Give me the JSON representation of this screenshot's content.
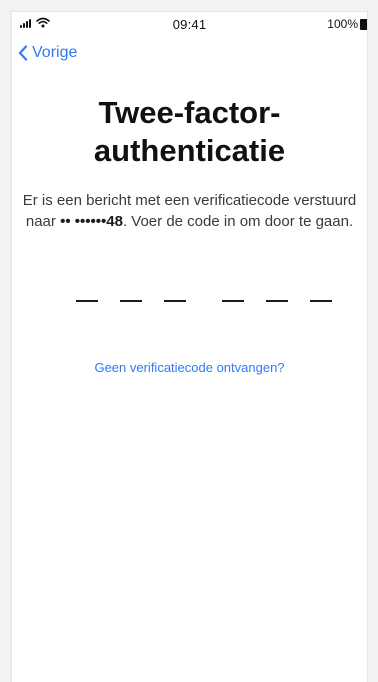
{
  "status_bar": {
    "time": "09:41",
    "battery_percent": "100%"
  },
  "navigation": {
    "back_label": "Vorige"
  },
  "title": "Twee-factor-authenticatie",
  "description": {
    "text_before": "Er is een bericht met een verificatiecode verstuurd naar ",
    "masked_number": "•• ••••••48",
    "text_after": ". Voer de code in om door te gaan."
  },
  "code_entry": {
    "digit_count": 6,
    "group_size": 3,
    "digits": [
      "",
      "",
      "",
      "",
      "",
      ""
    ]
  },
  "no_code_link": "Geen verificatiecode ontvangen?",
  "colors": {
    "accent": "#2f7bf5",
    "text": "#111111"
  }
}
